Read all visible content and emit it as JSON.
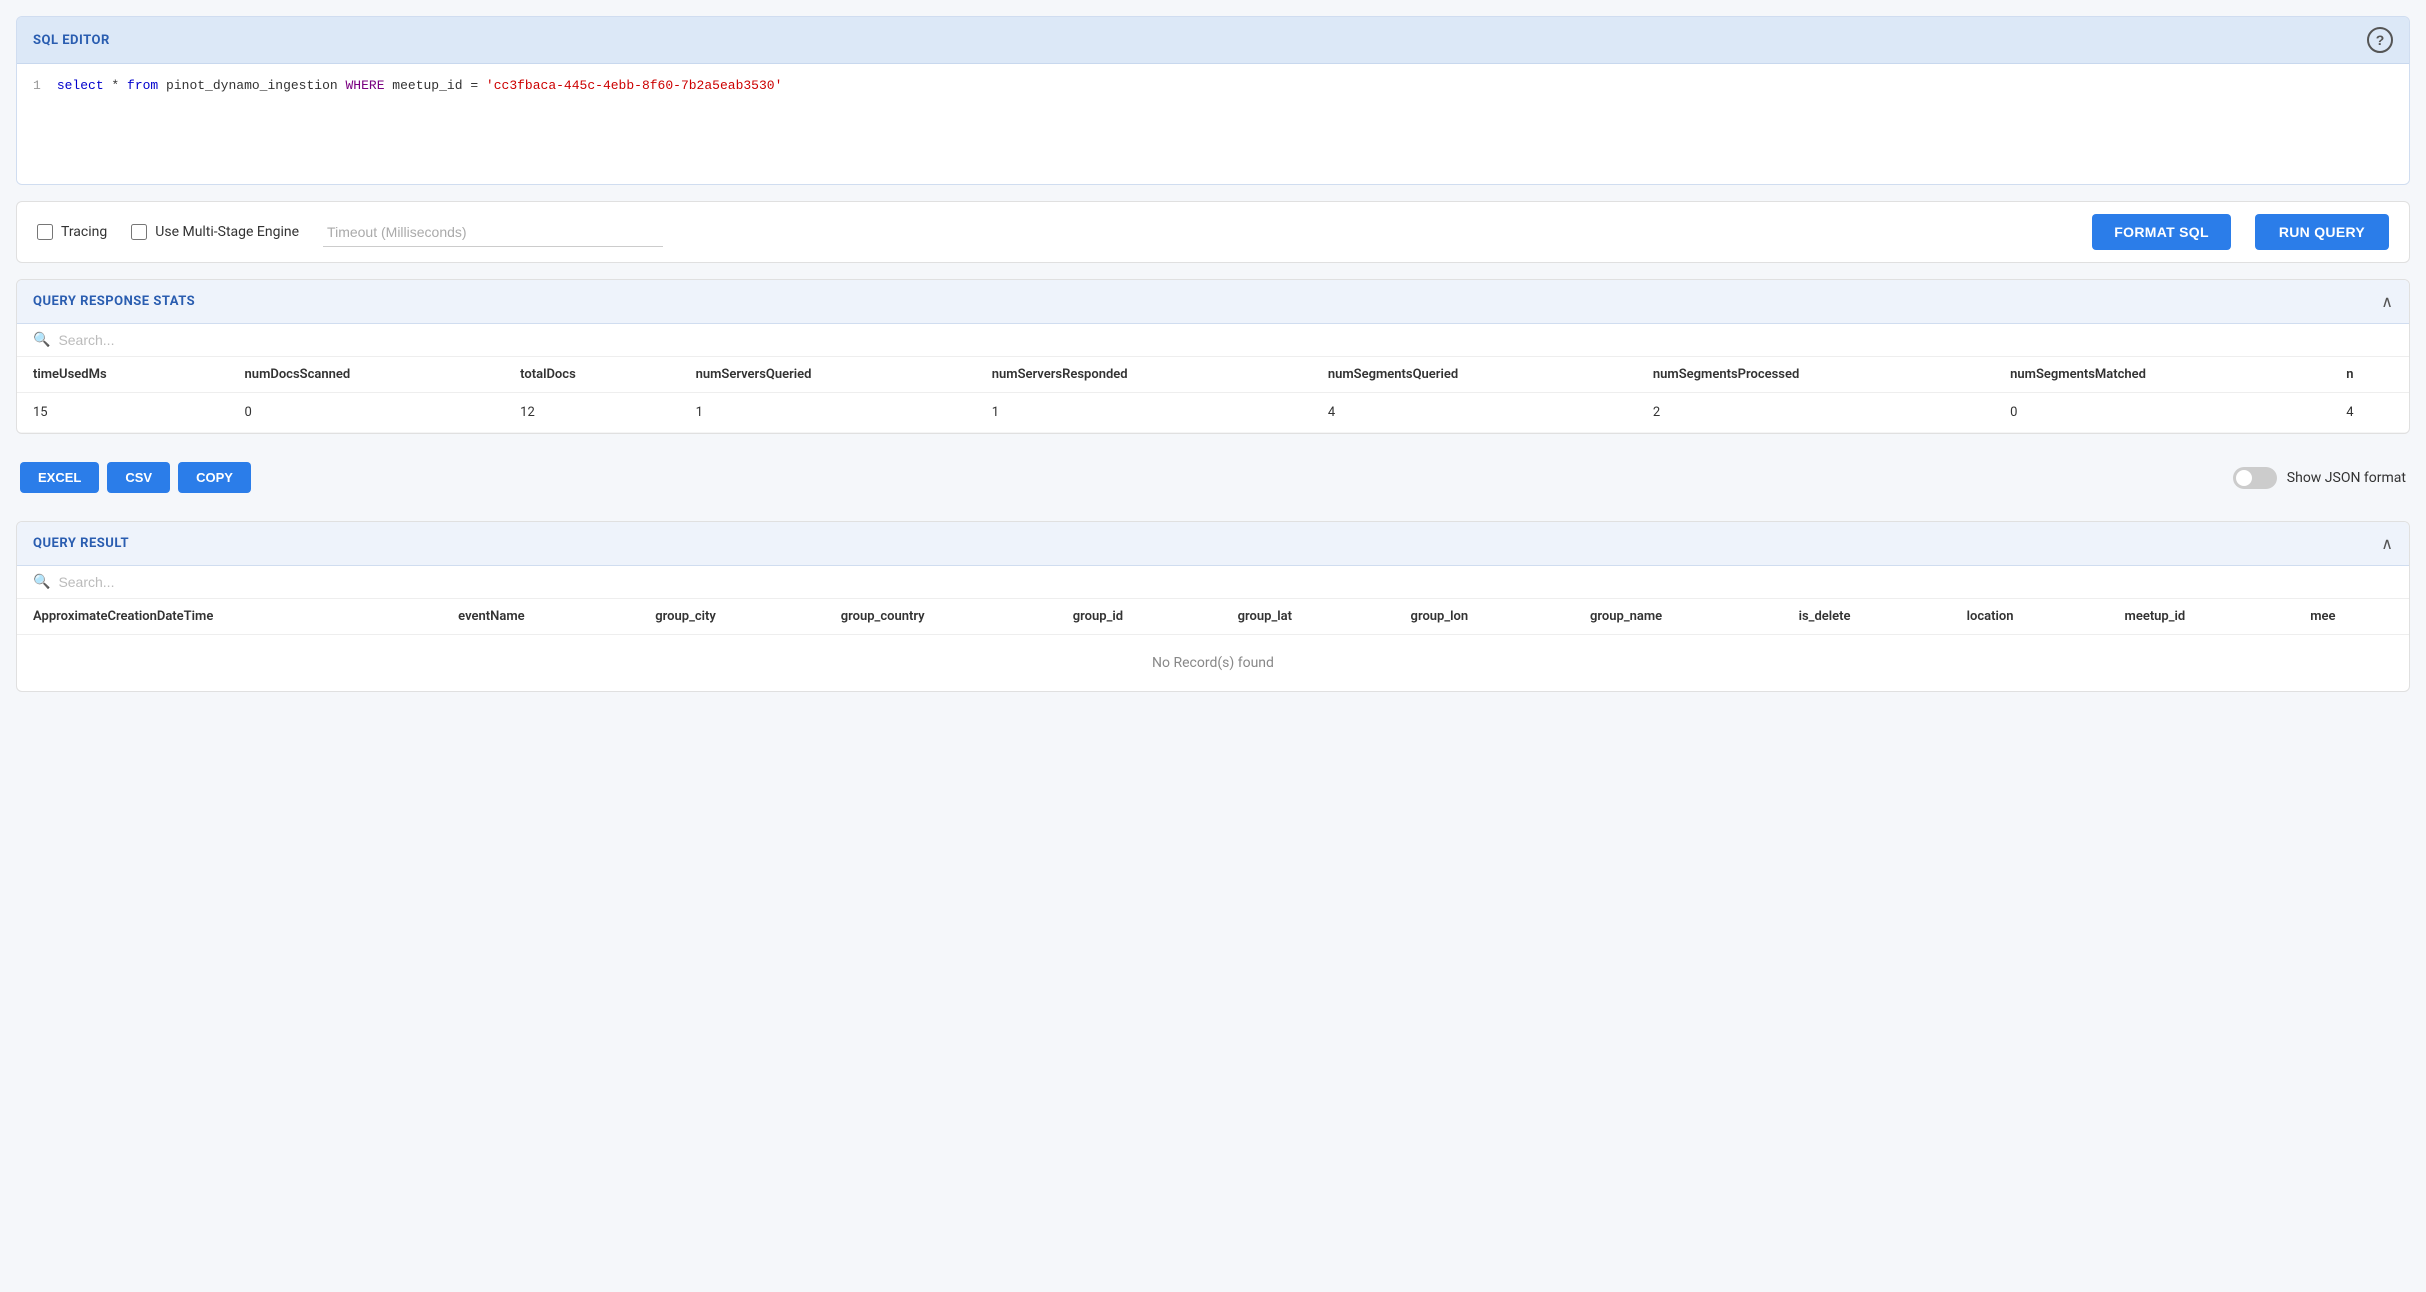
{
  "sqlEditor": {
    "title": "SQL EDITOR",
    "helpIcon": "?",
    "query": {
      "lineNumber": "1",
      "selectPart": "select * from pinot_dynamo_ingestion",
      "wherePart": "WHERE",
      "conditionPart": " meetup_id = ",
      "stringValue": "'cc3fbaca-445c-4ebb-8f60-7b2a5eab3530'"
    }
  },
  "toolbar": {
    "tracingLabel": "Tracing",
    "multiStageLabel": "Use Multi-Stage Engine",
    "timeoutPlaceholder": "Timeout (Milliseconds)",
    "formatSqlLabel": "FORMAT SQL",
    "runQueryLabel": "RUN QUERY"
  },
  "queryResponseStats": {
    "title": "QUERY RESPONSE STATS",
    "searchPlaceholder": "Search...",
    "columns": [
      "timeUsedMs",
      "numDocsScanned",
      "totalDocs",
      "numServersQueried",
      "numServersResponded",
      "numSegmentsQueried",
      "numSegmentsProcessed",
      "numSegmentsMatched",
      "n"
    ],
    "rows": [
      {
        "timeUsedMs": "15",
        "numDocsScanned": "0",
        "totalDocs": "12",
        "numServersQueried": "1",
        "numServersResponded": "1",
        "numSegmentsQueried": "4",
        "numSegmentsProcessed": "2",
        "numSegmentsMatched": "0",
        "n": "4"
      }
    ]
  },
  "exportToolbar": {
    "excelLabel": "EXCEL",
    "csvLabel": "CSV",
    "copyLabel": "COPY",
    "jsonToggleLabel": "Show JSON format"
  },
  "queryResult": {
    "title": "QUERY RESULT",
    "searchPlaceholder": "Search...",
    "columns": [
      "ApproximateCreationDateTime",
      "eventName",
      "group_city",
      "group_country",
      "group_id",
      "group_lat",
      "group_lon",
      "group_name",
      "is_delete",
      "location",
      "meetup_id",
      "mee"
    ],
    "noRecordsText": "No Record(s) found"
  },
  "icons": {
    "search": "🔍",
    "collapse": "∧",
    "help": "?"
  }
}
